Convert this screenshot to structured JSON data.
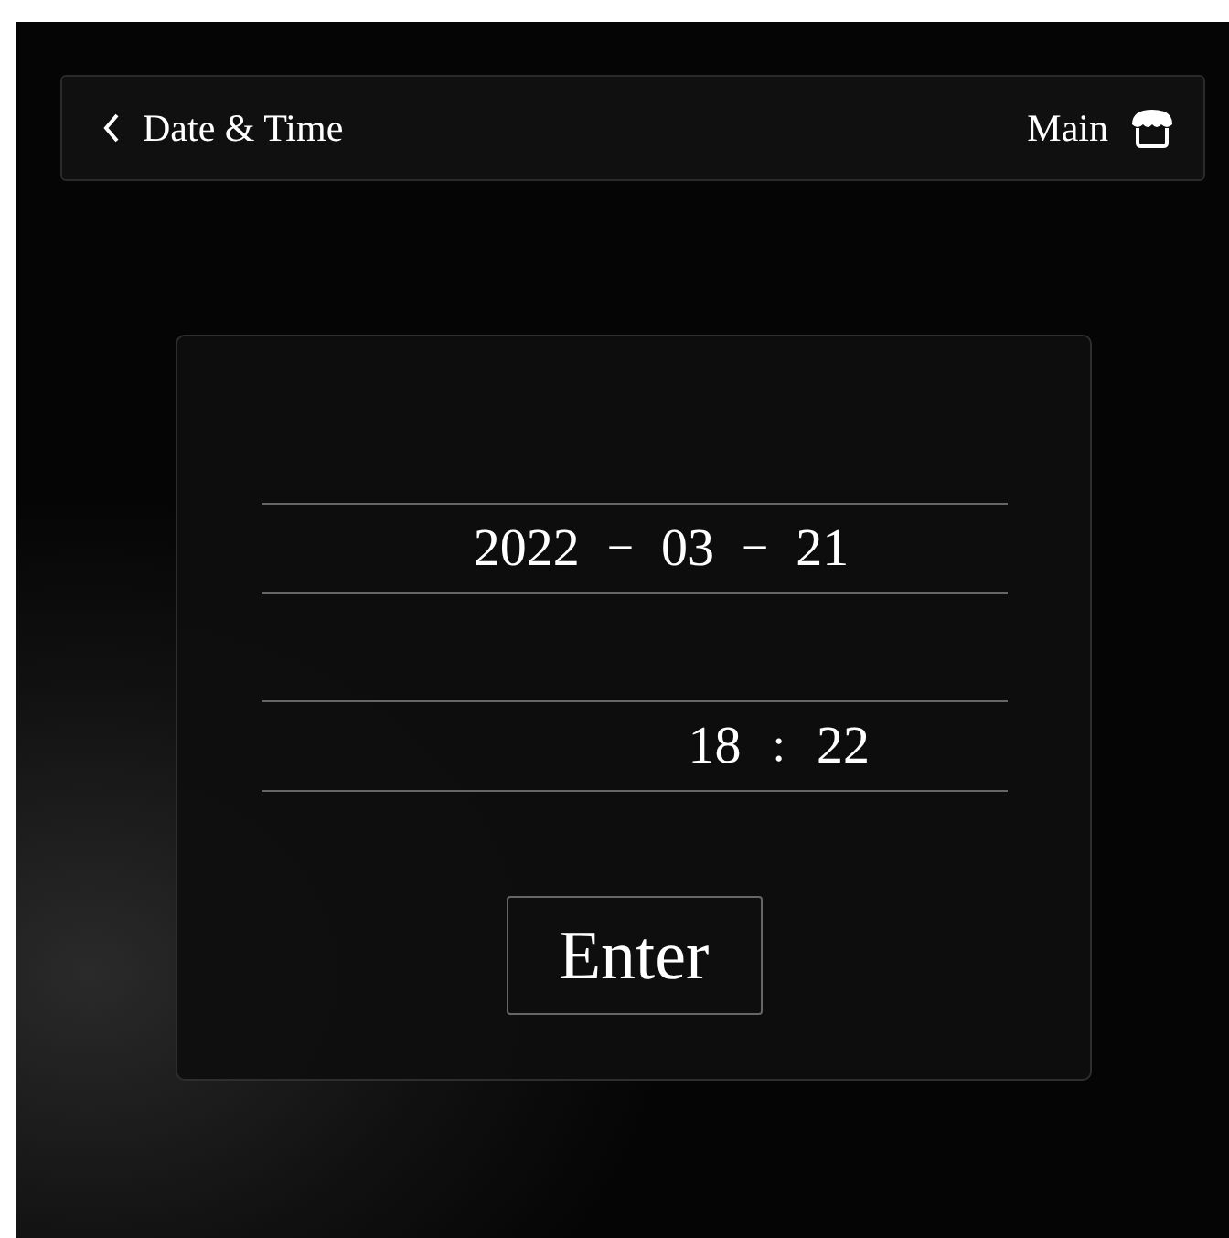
{
  "header": {
    "title": "Date & Time",
    "home_label": "Main"
  },
  "date": {
    "parts": [
      "2022",
      "03",
      "21"
    ],
    "separators": [
      "−",
      "−"
    ]
  },
  "time": {
    "parts": [
      "18",
      "22"
    ],
    "separators": [
      ":"
    ]
  },
  "button": "Enter"
}
